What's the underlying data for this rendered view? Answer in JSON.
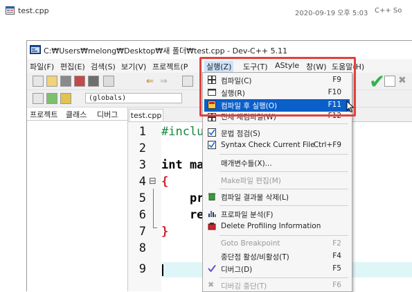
{
  "explorer": {
    "file_name": "test.cpp",
    "modified": "2020-09-19 오후 5:03",
    "type": "C++ So"
  },
  "window": {
    "title": "C:₩Users₩melong₩Desktop₩새 폴더₩test.cpp - Dev-C++ 5.11"
  },
  "menubar": {
    "items": [
      "파일(F)",
      "편집(E)",
      "검색(S)",
      "보기(V)",
      "프로젝트(P",
      "실행(Z)",
      "도구(T)",
      "AStyle",
      "창(W)",
      "도움말(H)"
    ]
  },
  "toolbar": {
    "globals": "(globals)"
  },
  "left_panel": {
    "tabs": [
      "프로젝트",
      "클래스",
      "디버그"
    ]
  },
  "editor": {
    "tab": "test.cpp",
    "line_numbers": [
      "1",
      "2",
      "3",
      "4",
      "5",
      "6",
      "7",
      "8",
      "9"
    ],
    "code": [
      "#incluc",
      "",
      "int ma",
      "{",
      "    pr",
      "    re",
      "}",
      "",
      ""
    ],
    "fold_marker": "⊟"
  },
  "run_menu": {
    "items": [
      {
        "label": "컴파일(C)",
        "key": "F9"
      },
      {
        "label": "실행(R)",
        "key": "F10"
      },
      {
        "label": "컴파일 후 실행(O)",
        "key": "F11"
      },
      {
        "label": "전체 재컴파일(W)",
        "key": "F12"
      },
      {
        "label": "문법 점검(S)",
        "key": ""
      },
      {
        "label": "Syntax Check Current File",
        "key": "Ctrl+F9"
      },
      {
        "label": "매개변수들(X)...",
        "key": ""
      },
      {
        "label": "Make파일 편집(M)",
        "key": ""
      },
      {
        "label": "컴파일 결과물 삭제(L)",
        "key": ""
      },
      {
        "label": "프로파일 분석(F)",
        "key": ""
      },
      {
        "label": "Delete Profiling Information",
        "key": ""
      },
      {
        "label": "Goto Breakpoint",
        "key": "F2"
      },
      {
        "label": "중단점 활성/비활성(T)",
        "key": "F4"
      },
      {
        "label": "디버그(D)",
        "key": "F5"
      },
      {
        "label": "디버깅 중단(T)",
        "key": "F6"
      }
    ]
  },
  "colors": {
    "highlight": "#0a5fc9",
    "annotation": "#e2413b",
    "current_line": "#dff6f8"
  }
}
